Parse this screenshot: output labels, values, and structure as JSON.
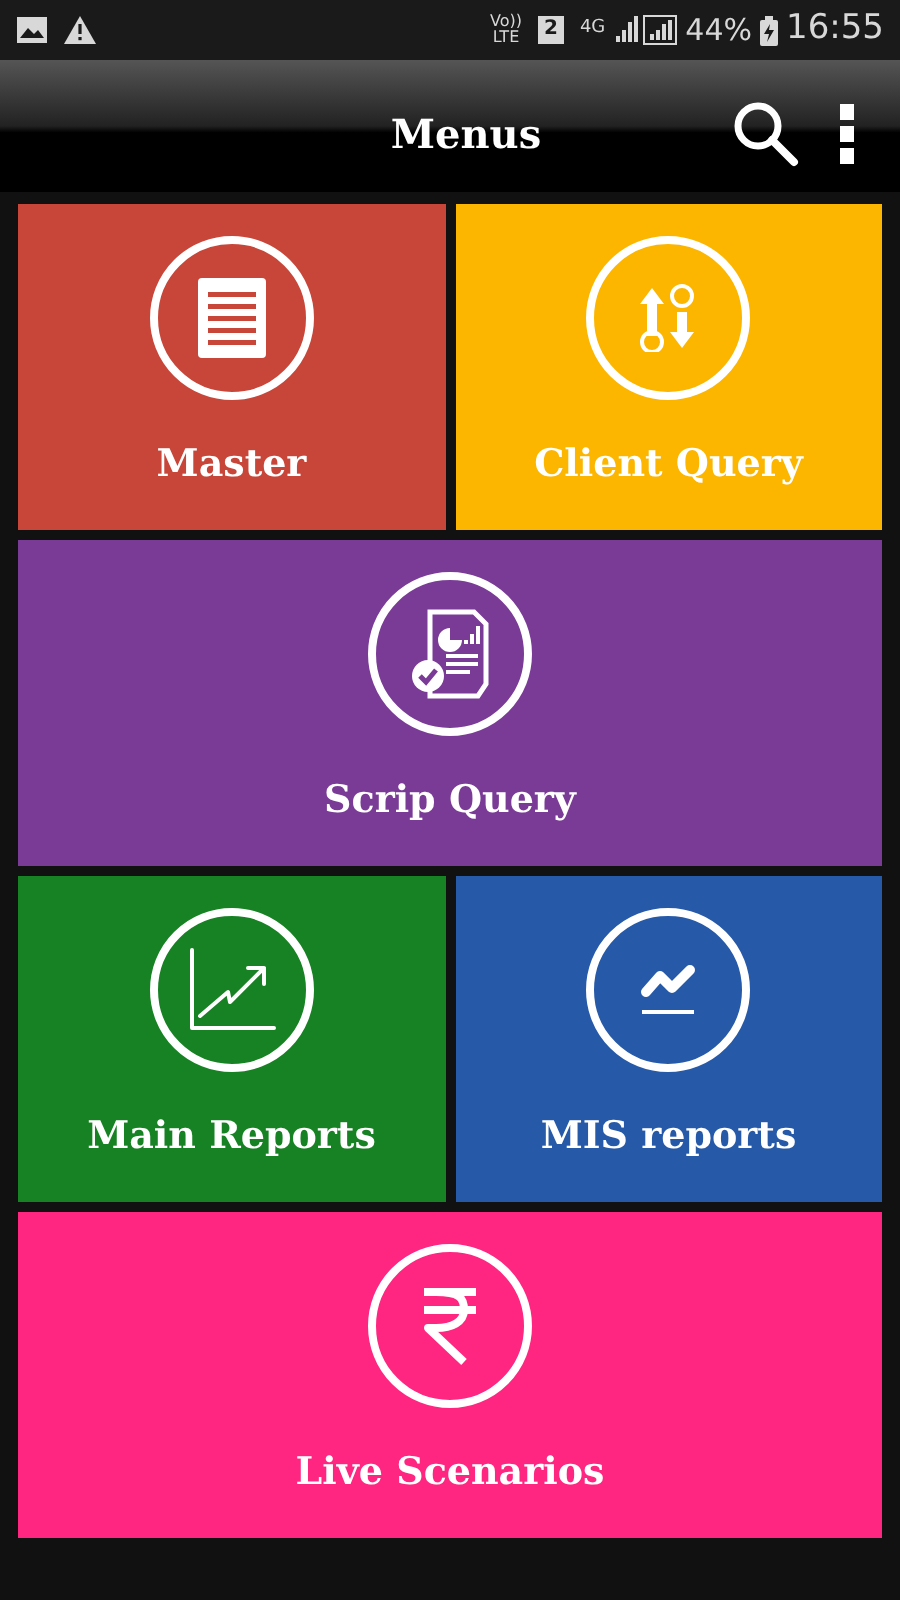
{
  "status_bar": {
    "volte": "Vo))",
    "lte": "LTE",
    "sim": "2",
    "network": "4G",
    "battery": "44%",
    "time": "16:55"
  },
  "app_bar": {
    "title": "Menus"
  },
  "tiles": [
    {
      "label": "Master",
      "kind": "document",
      "color": "#c84639",
      "wide": false
    },
    {
      "label": "Client Query",
      "kind": "transfer",
      "color": "#fcb600",
      "wide": false
    },
    {
      "label": "Scrip Query",
      "kind": "report",
      "color": "#7a3b96",
      "wide": true
    },
    {
      "label": "Main Reports",
      "kind": "chart",
      "color": "#178223",
      "wide": false
    },
    {
      "label": "MIS reports",
      "kind": "trend",
      "color": "#2659a8",
      "wide": false
    },
    {
      "label": "Live Scenarios",
      "kind": "rupee",
      "color": "#fe2680",
      "wide": true
    }
  ]
}
